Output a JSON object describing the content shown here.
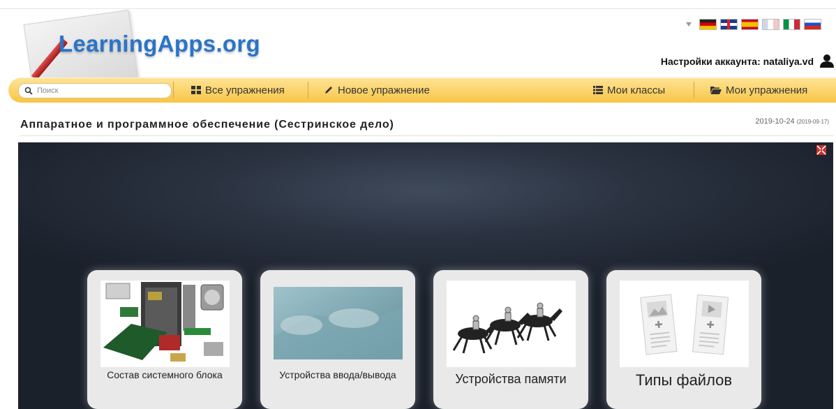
{
  "logo": {
    "text": "LearningApps.org"
  },
  "languages": [
    "de",
    "gb",
    "es",
    "fr",
    "it",
    "ru"
  ],
  "account": {
    "label": "Настройки аккаунта: nataliya.vd"
  },
  "nav": {
    "search_placeholder": "Поиск",
    "all_exercises": "Все упражнения",
    "new_exercise": "Новое упражнение",
    "my_classes": "Мои классы",
    "my_exercises": "Мои упражнения"
  },
  "page": {
    "title": "Аппаратное и программное обеспечение (Сестринское дело)",
    "date": "2019-10-24",
    "date_small": "(2019-09-17)"
  },
  "cards": [
    {
      "label": "Состав системного блока",
      "icon": "computer-hardware-image"
    },
    {
      "label": "Устройства ввода/вывода",
      "icon": "keyboard-hands-image"
    },
    {
      "label": "Устройства памяти",
      "icon": "horse-race-image"
    },
    {
      "label": "Типы файлов",
      "icon": "new-app-placeholder-image"
    }
  ],
  "colors": {
    "navbar": "#f7c545",
    "logo_text": "#2a74c8",
    "stage": "#2a3240"
  }
}
